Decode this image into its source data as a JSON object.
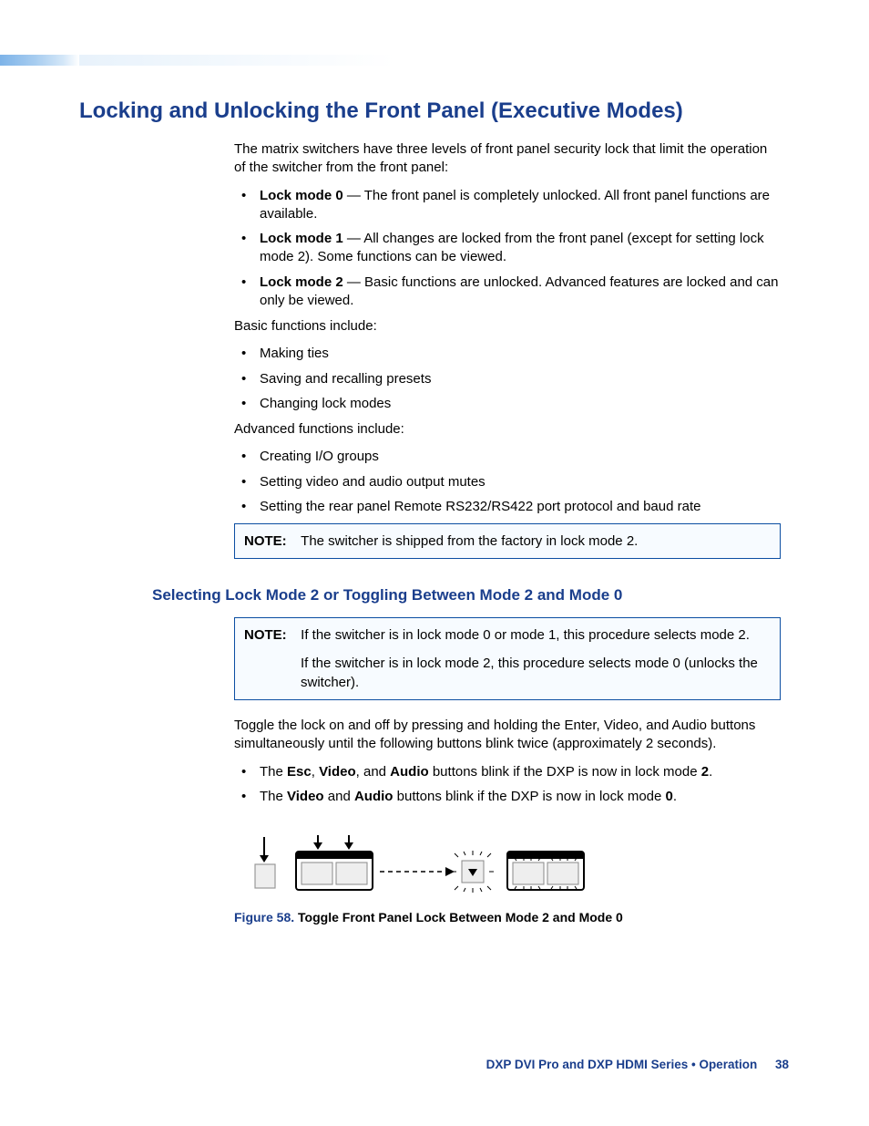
{
  "heading_main": "Locking and Unlocking the Front Panel (Executive Modes)",
  "intro": "The matrix switchers have three levels of front panel security lock that limit the operation of the switcher from the front panel:",
  "lock_modes": [
    {
      "label": "Lock mode 0",
      "text": " — The front panel is completely unlocked. All front panel functions are available."
    },
    {
      "label": "Lock mode 1",
      "text": " — All changes are locked from the front panel (except for setting lock mode 2). Some functions can be viewed."
    },
    {
      "label": "Lock mode 2",
      "text": " — Basic functions are unlocked. Advanced features are locked and can only be viewed."
    }
  ],
  "basic_heading": "Basic functions include:",
  "basic_list": [
    "Making ties",
    "Saving and recalling presets",
    "Changing lock modes"
  ],
  "advanced_heading": "Advanced functions include:",
  "advanced_list": [
    "Creating I/O groups",
    "Setting video and audio output mutes",
    "Setting the rear panel Remote RS232/RS422 port protocol and baud rate"
  ],
  "note1_label": "NOTE:",
  "note1_text": "The switcher is shipped from the factory in lock mode 2.",
  "heading_sub": "Selecting Lock Mode 2 or Toggling Between Mode 2 and Mode 0",
  "note2_label": "NOTE:",
  "note2_text1": "If the switcher is in lock mode 0 or mode 1, this procedure selects mode 2.",
  "note2_text2": "If the switcher is in lock mode 2, this procedure selects mode 0 (unlocks the switcher).",
  "toggle_para": "Toggle the lock on and off by pressing and holding the Enter, Video, and Audio buttons simultaneously until the following buttons blink twice (approximately 2 seconds).",
  "toggle_bullets": {
    "b1_pre": "The ",
    "b1_esc": "Esc",
    "b1_c1": ", ",
    "b1_video": "Video",
    "b1_c2": ", and ",
    "b1_audio": "Audio",
    "b1_mid": " buttons blink if the DXP is now in lock mode ",
    "b1_mode": "2",
    "b1_end": ".",
    "b2_pre": "The ",
    "b2_video": "Video",
    "b2_c": " and ",
    "b2_audio": "Audio",
    "b2_mid": " buttons blink if the DXP is now in lock mode ",
    "b2_mode": "0",
    "b2_end": "."
  },
  "figure_label": "Figure 58.",
  "figure_text": "Toggle Front Panel Lock Between Mode 2 and Mode 0",
  "footer_text": "DXP DVI Pro and DXP HDMI Series • Operation",
  "footer_page": "38"
}
